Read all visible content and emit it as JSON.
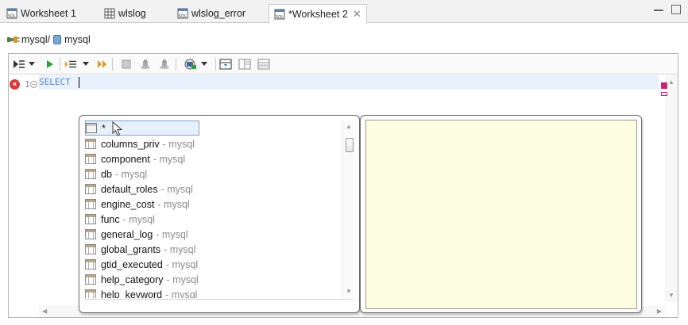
{
  "tabs": [
    {
      "label": "Worksheet 1",
      "active": false
    },
    {
      "label": "wlslog",
      "active": false
    },
    {
      "label": "wlslog_error",
      "active": false
    },
    {
      "label": "*Worksheet 2",
      "active": true
    }
  ],
  "breadcrumb": {
    "connection": "mysql/",
    "database": "mysql"
  },
  "toolbar": {
    "icons": [
      "run-icon",
      "run-dropdown-icon",
      "run-current-icon",
      "execute-plan-icon",
      "plan-dropdown-icon",
      "step-icon",
      "stop-icon",
      "commit-icon",
      "rollback-icon",
      "connection-icon",
      "connection-dropdown-icon",
      "toggle-layout-icon",
      "split-vertical-icon",
      "split-horizontal-icon"
    ]
  },
  "editor": {
    "line_number": "1",
    "code": "SELECT",
    "error_marker": "×"
  },
  "completion": {
    "items": [
      {
        "name": "*",
        "schema": ""
      },
      {
        "name": "columns_priv",
        "schema": "- mysql"
      },
      {
        "name": "component",
        "schema": "- mysql"
      },
      {
        "name": "db",
        "schema": "- mysql"
      },
      {
        "name": "default_roles",
        "schema": "- mysql"
      },
      {
        "name": "engine_cost",
        "schema": "- mysql"
      },
      {
        "name": "func",
        "schema": "- mysql"
      },
      {
        "name": "general_log",
        "schema": "- mysql"
      },
      {
        "name": "global_grants",
        "schema": "- mysql"
      },
      {
        "name": "gtid_executed",
        "schema": "- mysql"
      },
      {
        "name": "help_category",
        "schema": "- mysql"
      },
      {
        "name": "help_keyword",
        "schema": "- mysql"
      }
    ],
    "selected_index": 0
  },
  "colors": {
    "accent": "#5b7fbf",
    "marker": "#c2257b",
    "detail_bg": "#fdfde1"
  }
}
